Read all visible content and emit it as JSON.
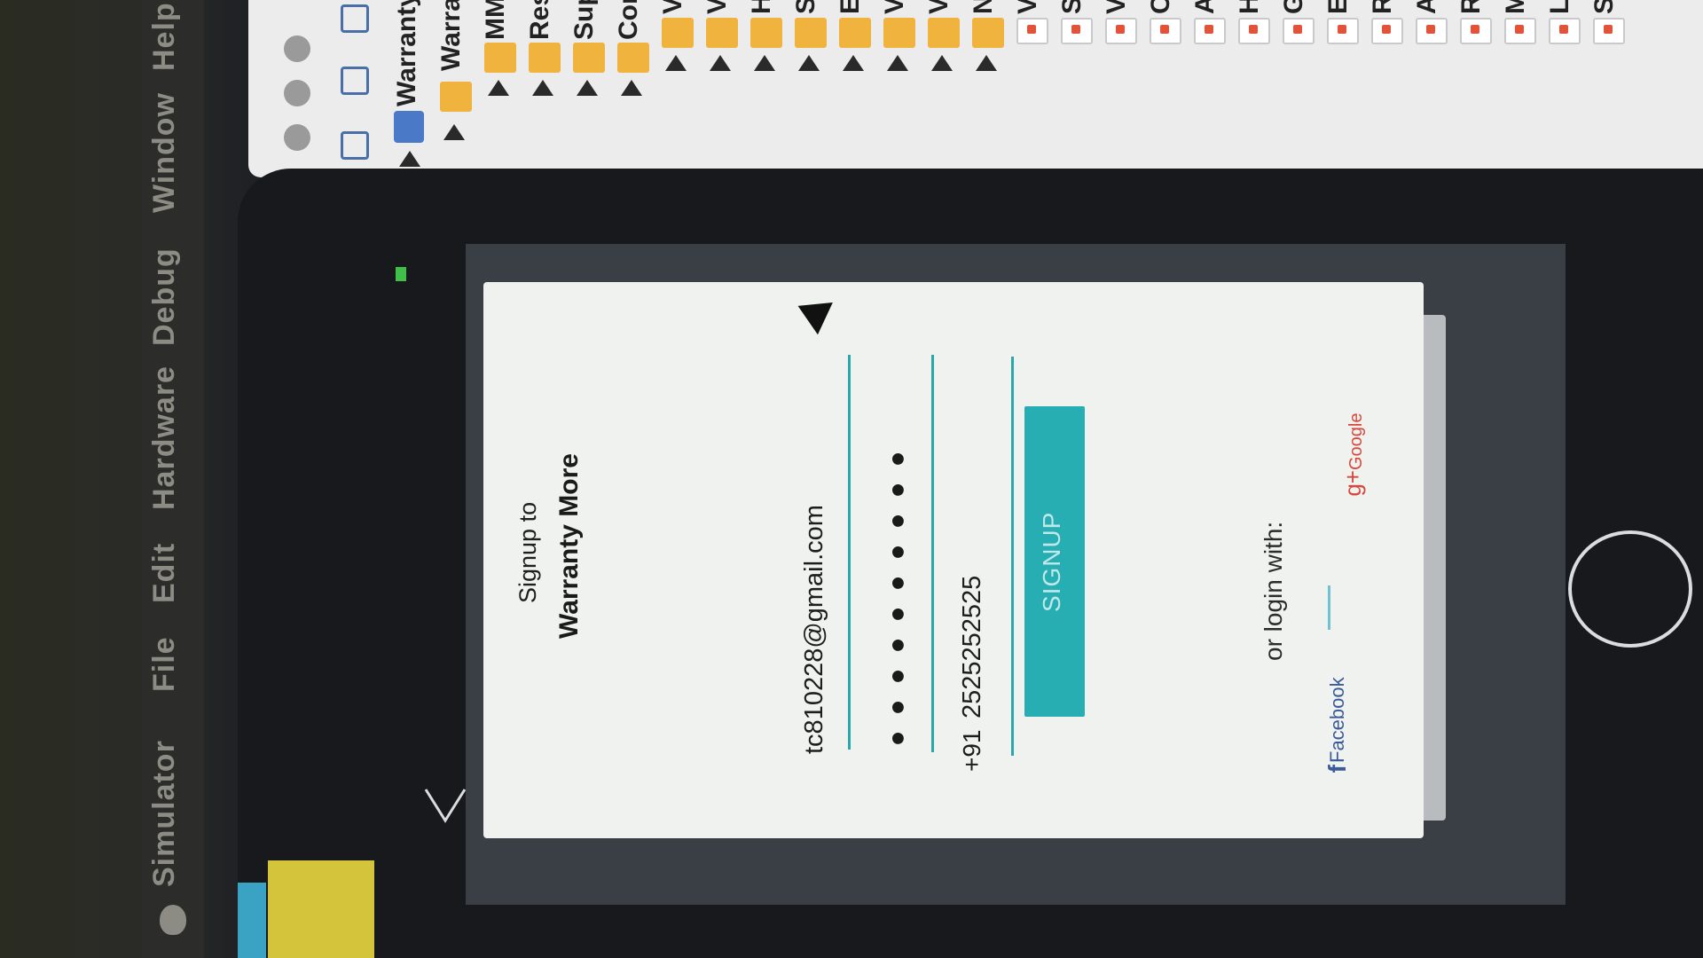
{
  "menubar": {
    "items": [
      "Simulator",
      "File",
      "Edit",
      "Hardware",
      "Debug",
      "Window",
      "Help"
    ]
  },
  "navigator": {
    "project_name": "Warranty",
    "group_name": "Warra",
    "columns": [
      {
        "label": "MM",
        "icon": "folder-icon"
      },
      {
        "label": "Res",
        "icon": "folder-icon"
      },
      {
        "label": "Sup",
        "icon": "folder-icon"
      },
      {
        "label": "Cor",
        "icon": "folder-icon"
      },
      {
        "label": "V",
        "icon": "folder-icon"
      },
      {
        "label": "V",
        "icon": "folder-icon"
      },
      {
        "label": "H",
        "icon": "folder-icon"
      },
      {
        "label": "S",
        "icon": "folder-icon"
      },
      {
        "label": "E",
        "icon": "folder-icon"
      },
      {
        "label": "V",
        "icon": "folder-icon"
      },
      {
        "label": "V",
        "icon": "folder-icon"
      },
      {
        "label": "N",
        "icon": "folder-icon"
      },
      {
        "label": "V",
        "icon": "file-icon"
      },
      {
        "label": "S",
        "icon": "file-icon"
      },
      {
        "label": "V",
        "icon": "file-icon"
      },
      {
        "label": "C",
        "icon": "file-icon"
      },
      {
        "label": "A",
        "icon": "file-icon"
      },
      {
        "label": "H",
        "icon": "file-icon"
      },
      {
        "label": "G",
        "icon": "file-icon"
      },
      {
        "label": "E",
        "icon": "file-icon"
      },
      {
        "label": "R",
        "icon": "file-icon"
      },
      {
        "label": "A",
        "icon": "file-icon"
      },
      {
        "label": "R",
        "icon": "file-icon"
      },
      {
        "label": "M",
        "icon": "file-icon"
      },
      {
        "label": "L",
        "icon": "file-icon"
      },
      {
        "label": "S",
        "icon": "file-icon"
      }
    ]
  },
  "signup": {
    "heading": "Signup to",
    "app_name": "Warranty More",
    "email_value": "tc810228@gmail.com",
    "password_value": "●●●●●●●●●●",
    "country_code": "+91",
    "phone_value": "2525252525",
    "submit_label": "SIGNUP",
    "alt_login_label": "or login with:",
    "facebook_icon": "f",
    "facebook_label": "Facebook",
    "google_icon": "g+",
    "google_label": "Google"
  },
  "colors": {
    "accent": "#2aa7a8",
    "button": "#27aeb3",
    "facebook": "#3b5a9a",
    "google": "#d9473a"
  }
}
